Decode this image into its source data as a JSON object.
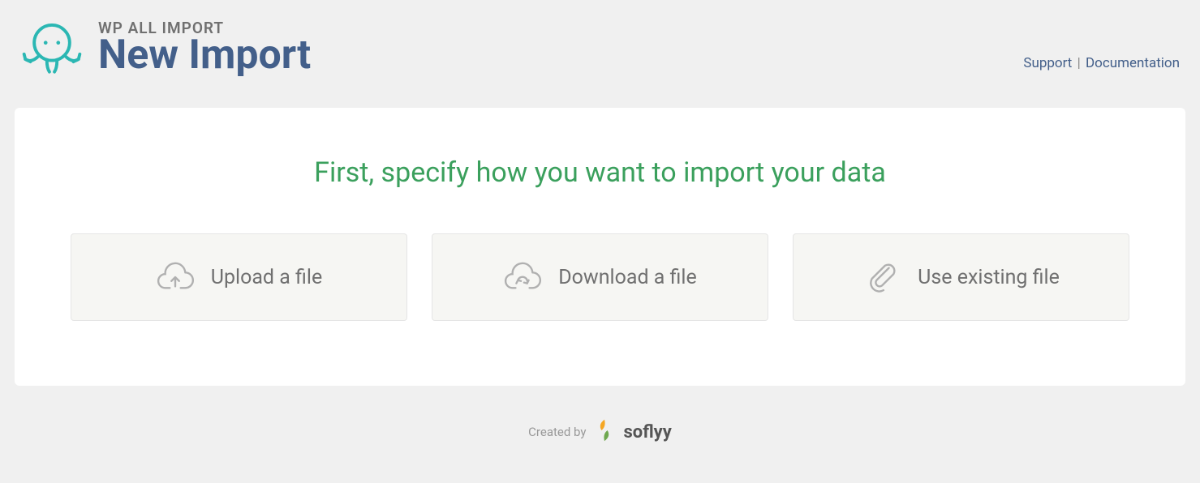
{
  "header": {
    "app_title": "WP ALL IMPORT",
    "page_title": "New Import",
    "links": {
      "support": "Support",
      "documentation": "Documentation",
      "divider": "|"
    }
  },
  "main": {
    "heading": "First, specify how you want to import your data",
    "options": [
      {
        "label": "Upload a file"
      },
      {
        "label": "Download a file"
      },
      {
        "label": "Use existing file"
      }
    ]
  },
  "footer": {
    "created_by": "Created by",
    "brand": "soflyy"
  }
}
